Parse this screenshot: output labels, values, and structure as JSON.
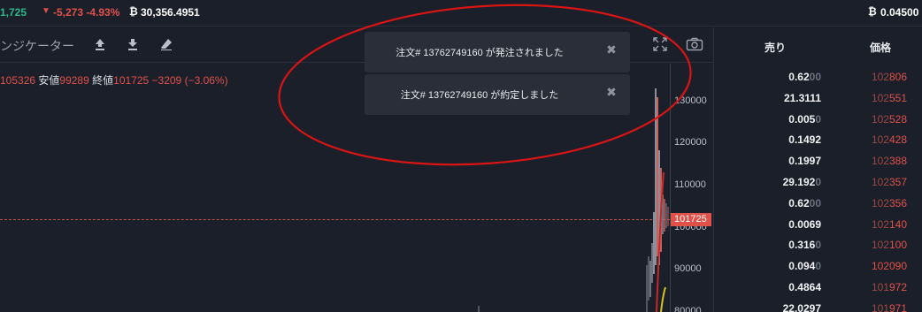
{
  "topbar": {
    "last_price": "1,725",
    "change": "-5,273 -4.93%",
    "btc_symbol": "₿",
    "volume": "30,356.4951",
    "right_btc_symbol": "₿",
    "right_value": "0.04500"
  },
  "toolbar": {
    "indicator_label": "ンジケーター",
    "icons": [
      "upload-icon",
      "download-icon",
      "eraser-icon",
      "fullscreen-icon",
      "camera-icon"
    ]
  },
  "ohlc": {
    "high_value": "105326",
    "low_label": "安値",
    "low_value": "99289",
    "close_label": "終値",
    "close_value": "101725",
    "change_value": "−3209 (−3.06%)"
  },
  "yaxis": {
    "labels": [
      "130000",
      "120000",
      "110000",
      "100000",
      "90000",
      "80000"
    ],
    "current_price": "101725"
  },
  "orderbook": {
    "headers": {
      "size": "売り",
      "price": "価格"
    },
    "rows": [
      {
        "size_main": "0.62",
        "size_dim": "00",
        "price_dim": "102",
        "price_main": "806"
      },
      {
        "size_main": "21.3111",
        "size_dim": "",
        "price_dim": "102",
        "price_main": "551"
      },
      {
        "size_main": "0.005",
        "size_dim": "0",
        "price_dim": "102",
        "price_main": "528"
      },
      {
        "size_main": "0.1492",
        "size_dim": "",
        "price_dim": "102",
        "price_main": "428"
      },
      {
        "size_main": "0.1997",
        "size_dim": "",
        "price_dim": "102",
        "price_main": "388"
      },
      {
        "size_main": "29.192",
        "size_dim": "0",
        "price_dim": "102",
        "price_main": "357"
      },
      {
        "size_main": "0.62",
        "size_dim": "00",
        "price_dim": "102",
        "price_main": "356"
      },
      {
        "size_main": "0.0069",
        "size_dim": "",
        "price_dim": "102",
        "price_main": "140"
      },
      {
        "size_main": "0.316",
        "size_dim": "0",
        "price_dim": "102",
        "price_main": "100"
      },
      {
        "size_main": "0.094",
        "size_dim": "0",
        "price_dim": "",
        "price_main": "102090"
      },
      {
        "size_main": "0.4864",
        "size_dim": "",
        "price_dim": "101",
        "price_main": "972"
      },
      {
        "size_main": "22.0297",
        "size_dim": "",
        "price_dim": "101",
        "price_main": "971"
      }
    ]
  },
  "toasts": [
    {
      "message": "注文# 13762749160 が発注されました",
      "close": "✖"
    },
    {
      "message": "注文# 13762749160 が約定しました",
      "close": "✖"
    }
  ],
  "colors": {
    "background": "#1b1f2a",
    "up": "#2cb78b",
    "down": "#e0514a",
    "annotation": "#d81414"
  }
}
